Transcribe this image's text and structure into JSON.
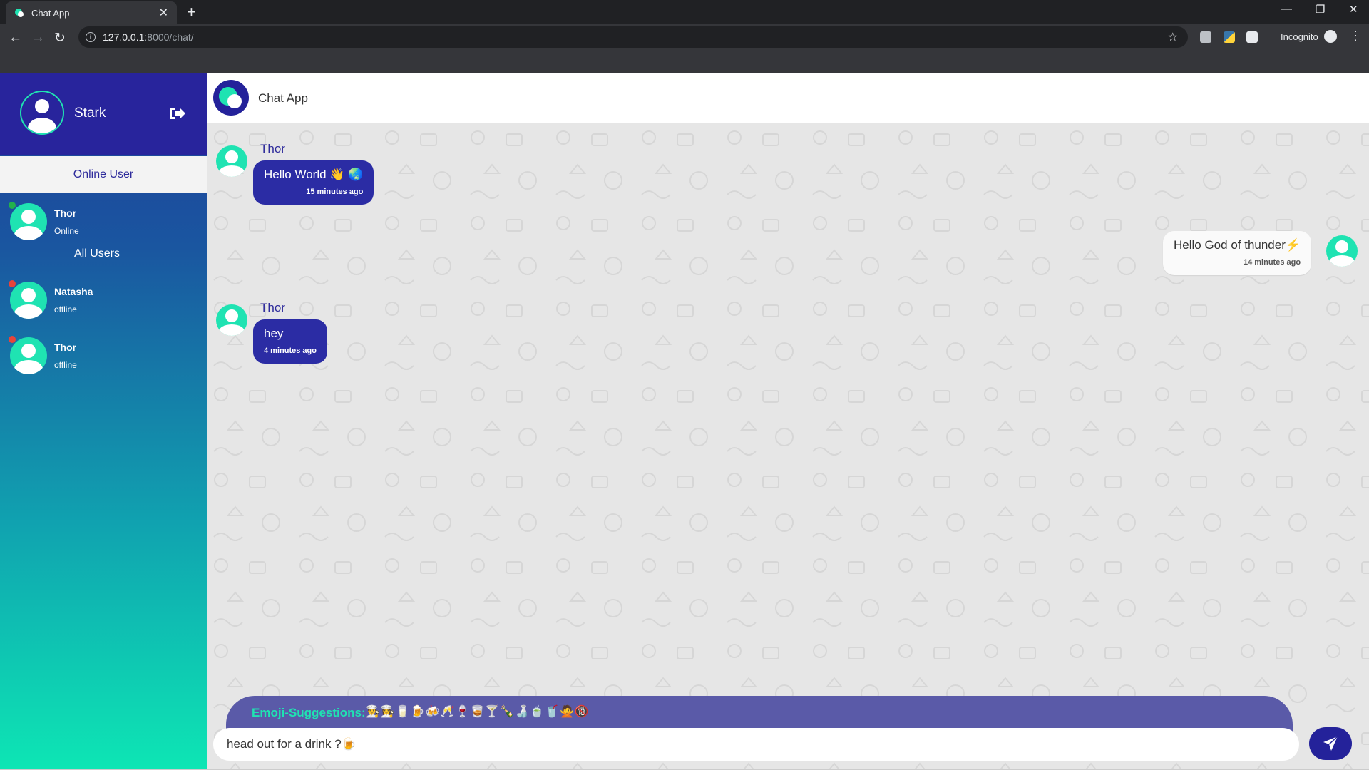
{
  "browser": {
    "tab_title": "Chat App",
    "url_host": "127.0.0.1",
    "url_path": ":8000/chat/",
    "incognito_label": "Incognito"
  },
  "sidebar": {
    "profile_name": "Stark",
    "online_section": "Online User",
    "online_users": [
      {
        "name": "Thor",
        "status": "Online",
        "dot_color": "#22b14c"
      }
    ],
    "all_section": "All Users",
    "all_users": [
      {
        "name": "Natasha",
        "status": "offline",
        "dot_color": "#e8443a"
      },
      {
        "name": "Thor",
        "status": "offline",
        "dot_color": "#e8443a"
      }
    ]
  },
  "header": {
    "title": "Chat App"
  },
  "messages": [
    {
      "direction": "in",
      "sender": "Thor",
      "text": "Hello World 👋 🌏",
      "time": "15 minutes ago"
    },
    {
      "direction": "out",
      "sender": "",
      "text": "Hello God of thunder⚡",
      "time": "14 minutes ago"
    },
    {
      "direction": "in",
      "sender": "Thor",
      "text": "hey",
      "time": "4 minutes ago"
    }
  ],
  "composer": {
    "emoji_label": "Emoji-Suggestions:",
    "emoji_suggestions": "👨‍🍳👩‍🍳🥛🍺🍻🥂🍷🥃🍸🍾🍶🍵🥤🙅🔞",
    "input_value": "head out for a drink ?🍺"
  },
  "colors": {
    "sidebar_top": "#28249c",
    "accent": "#1fe3b2",
    "bubble_in": "#2b2ca4",
    "send_button": "#24229a"
  }
}
